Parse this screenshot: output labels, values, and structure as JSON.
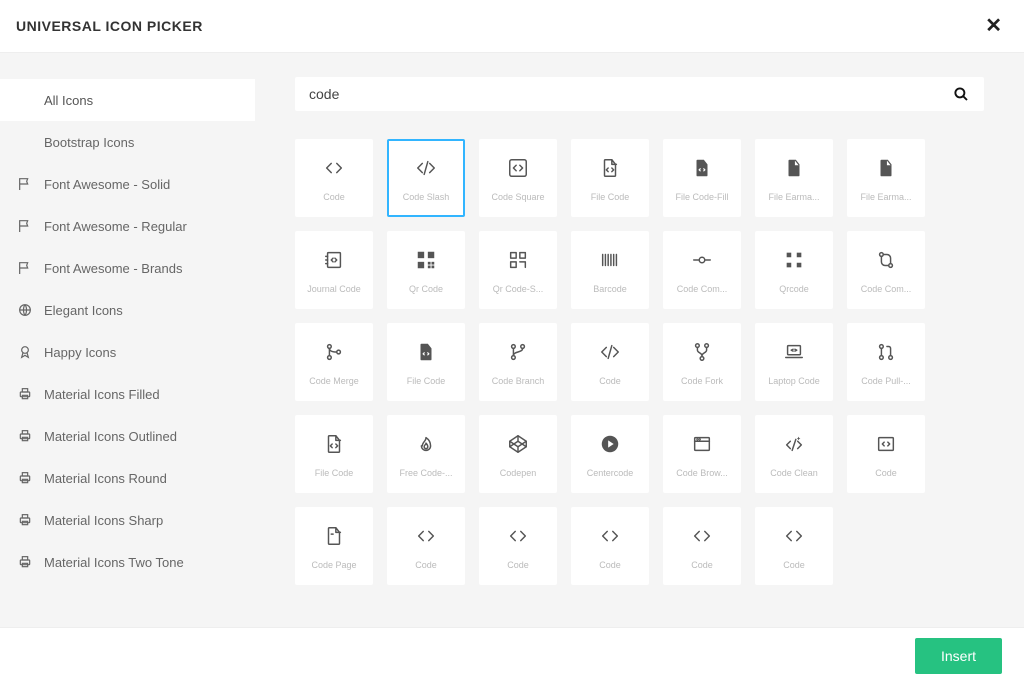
{
  "header": {
    "title": "UNIVERSAL ICON PICKER"
  },
  "search": {
    "value": "code",
    "placeholder": ""
  },
  "footer": {
    "insert_label": "Insert"
  },
  "sidebar": {
    "items": [
      {
        "label": "All Icons",
        "glyph": "",
        "active": true
      },
      {
        "label": "Bootstrap Icons",
        "glyph": "",
        "active": false
      },
      {
        "label": "Font Awesome - Solid",
        "glyph": "flag",
        "active": false
      },
      {
        "label": "Font Awesome - Regular",
        "glyph": "flag",
        "active": false
      },
      {
        "label": "Font Awesome - Brands",
        "glyph": "flag",
        "active": false
      },
      {
        "label": "Elegant Icons",
        "glyph": "globe",
        "active": false
      },
      {
        "label": "Happy Icons",
        "glyph": "award",
        "active": false
      },
      {
        "label": "Material Icons Filled",
        "glyph": "print",
        "active": false
      },
      {
        "label": "Material Icons Outlined",
        "glyph": "print",
        "active": false
      },
      {
        "label": "Material Icons Round",
        "glyph": "print",
        "active": false
      },
      {
        "label": "Material Icons Sharp",
        "glyph": "print",
        "active": false
      },
      {
        "label": "Material Icons Two Tone",
        "glyph": "print",
        "active": false
      }
    ]
  },
  "icons": [
    {
      "label": "Code",
      "glyph": "code",
      "selected": false
    },
    {
      "label": "Code Slash",
      "glyph": "code-slash",
      "selected": true
    },
    {
      "label": "Code Square",
      "glyph": "code-square",
      "selected": false
    },
    {
      "label": "File Code",
      "glyph": "file-code",
      "selected": false
    },
    {
      "label": "File Code-Fill",
      "glyph": "file-code-fill",
      "selected": false
    },
    {
      "label": "File Earma...",
      "glyph": "file-earmark",
      "selected": false
    },
    {
      "label": "File Earma...",
      "glyph": "file-earmark",
      "selected": false
    },
    {
      "label": "Journal Code",
      "glyph": "journal",
      "selected": false
    },
    {
      "label": "Qr Code",
      "glyph": "qr",
      "selected": false
    },
    {
      "label": "Qr Code-S...",
      "glyph": "qr-scan",
      "selected": false
    },
    {
      "label": "Barcode",
      "glyph": "barcode",
      "selected": false
    },
    {
      "label": "Code Com...",
      "glyph": "commit",
      "selected": false
    },
    {
      "label": "Qrcode",
      "glyph": "qr-small",
      "selected": false
    },
    {
      "label": "Code Com...",
      "glyph": "compare",
      "selected": false
    },
    {
      "label": "Code Merge",
      "glyph": "merge",
      "selected": false
    },
    {
      "label": "File Code",
      "glyph": "file-code-fill",
      "selected": false
    },
    {
      "label": "Code Branch",
      "glyph": "branch",
      "selected": false
    },
    {
      "label": "Code",
      "glyph": "code-slash",
      "selected": false
    },
    {
      "label": "Code Fork",
      "glyph": "fork",
      "selected": false
    },
    {
      "label": "Laptop Code",
      "glyph": "laptop",
      "selected": false
    },
    {
      "label": "Code Pull-...",
      "glyph": "pull-request",
      "selected": false
    },
    {
      "label": "File Code",
      "glyph": "file-code",
      "selected": false
    },
    {
      "label": "Free Code-...",
      "glyph": "fire",
      "selected": false
    },
    {
      "label": "Codepen",
      "glyph": "codepen",
      "selected": false
    },
    {
      "label": "Centercode",
      "glyph": "centercode",
      "selected": false
    },
    {
      "label": "Code Brow...",
      "glyph": "browser",
      "selected": false
    },
    {
      "label": "Code Clean",
      "glyph": "clean",
      "selected": false
    },
    {
      "label": "Code",
      "glyph": "code-box",
      "selected": false
    },
    {
      "label": "Code Page",
      "glyph": "page",
      "selected": false
    },
    {
      "label": "Code",
      "glyph": "code",
      "selected": false
    },
    {
      "label": "Code",
      "glyph": "code",
      "selected": false
    },
    {
      "label": "Code",
      "glyph": "code",
      "selected": false
    },
    {
      "label": "Code",
      "glyph": "code",
      "selected": false
    },
    {
      "label": "Code",
      "glyph": "code",
      "selected": false
    }
  ]
}
